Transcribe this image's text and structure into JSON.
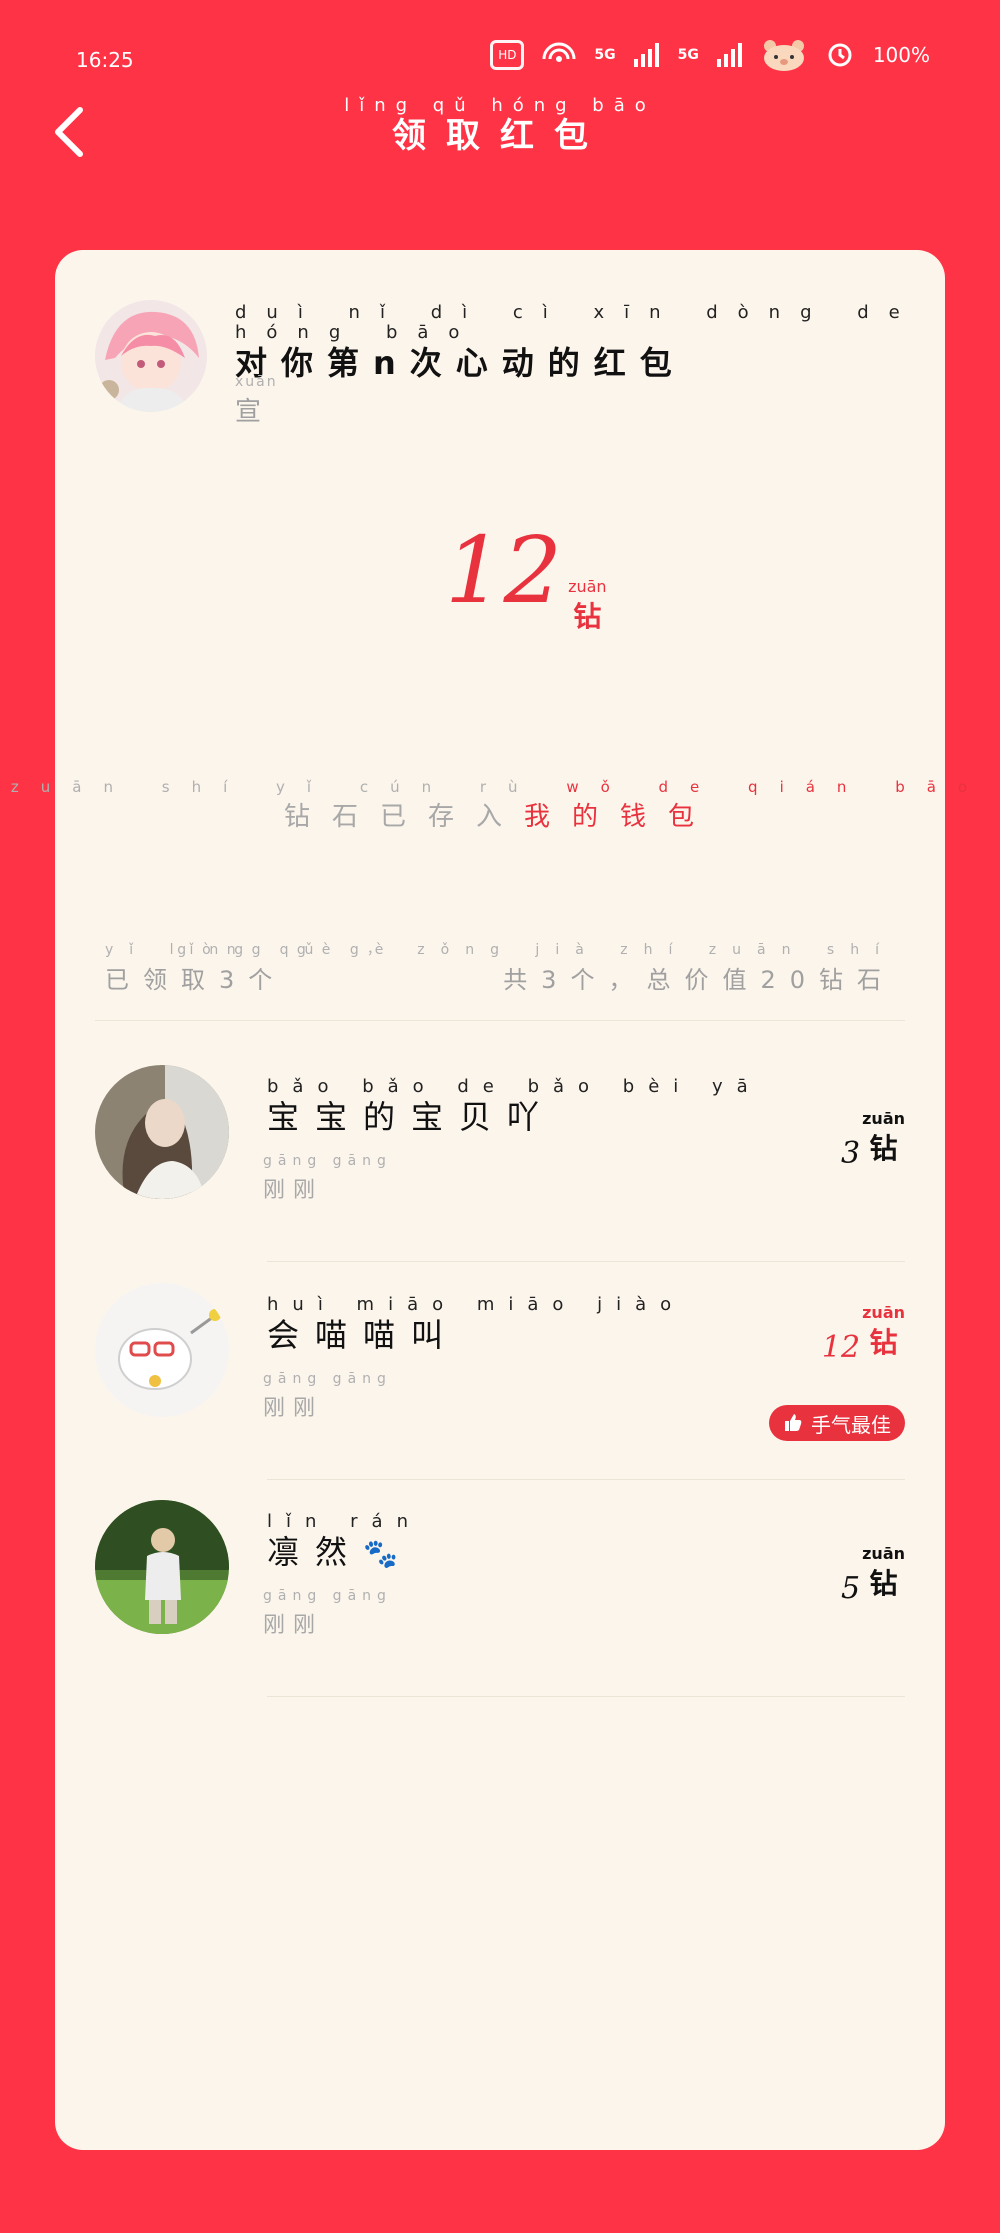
{
  "status_bar": {
    "time": "16:25",
    "network1": "5G",
    "network2": "5G",
    "battery": "100%"
  },
  "header": {
    "title_pinyin": "lǐng qǔ hóng bāo",
    "title": "领取红包"
  },
  "packet": {
    "title_pinyin": "duì nǐ dì cì xīn dòng de hóng bāo",
    "title": "对你第n次心动的红包",
    "sender_pinyin": "xuān",
    "sender": "宣",
    "amount": "12",
    "unit_pinyin": "zuān",
    "unit": "钻",
    "stored_pinyin_1": "zuān shí yǐ cún rù",
    "stored_text_1": "钻石已存入",
    "stored_pinyin_2": "wǒ de qián bāo",
    "stored_text_2": "我的钱包"
  },
  "stats": {
    "claimed_pinyin": "yǐ lǐng qǔ gè",
    "claimed": "已领取3个",
    "total_pinyin": "gòng gè ， zǒng jià zhí zuān shí",
    "total": "共3个，总价值20钻石"
  },
  "list": [
    {
      "name_pinyin": "bǎo bǎo de bǎo bèi yā",
      "name": "宝宝的宝贝吖",
      "time_pinyin": "gāng gāng",
      "time": "刚刚",
      "amount": "3",
      "unit_pinyin": "zuān",
      "unit": "钻",
      "best": false
    },
    {
      "name_pinyin": "huì miāo miāo jiào",
      "name": "会喵喵叫",
      "time_pinyin": "gāng gāng",
      "time": "刚刚",
      "amount": "12",
      "unit_pinyin": "zuān",
      "unit": "钻",
      "best": true,
      "best_label": "手气最佳"
    },
    {
      "name_pinyin": "lǐn rán",
      "name": "凛然",
      "name_icon": "🐾",
      "time_pinyin": "gāng gāng",
      "time": "刚刚",
      "amount": "5",
      "unit_pinyin": "zuān",
      "unit": "钻",
      "best": false
    }
  ],
  "colors": {
    "background": "#FF3346",
    "card": "#FCF5EC",
    "accent": "#E8333F"
  }
}
